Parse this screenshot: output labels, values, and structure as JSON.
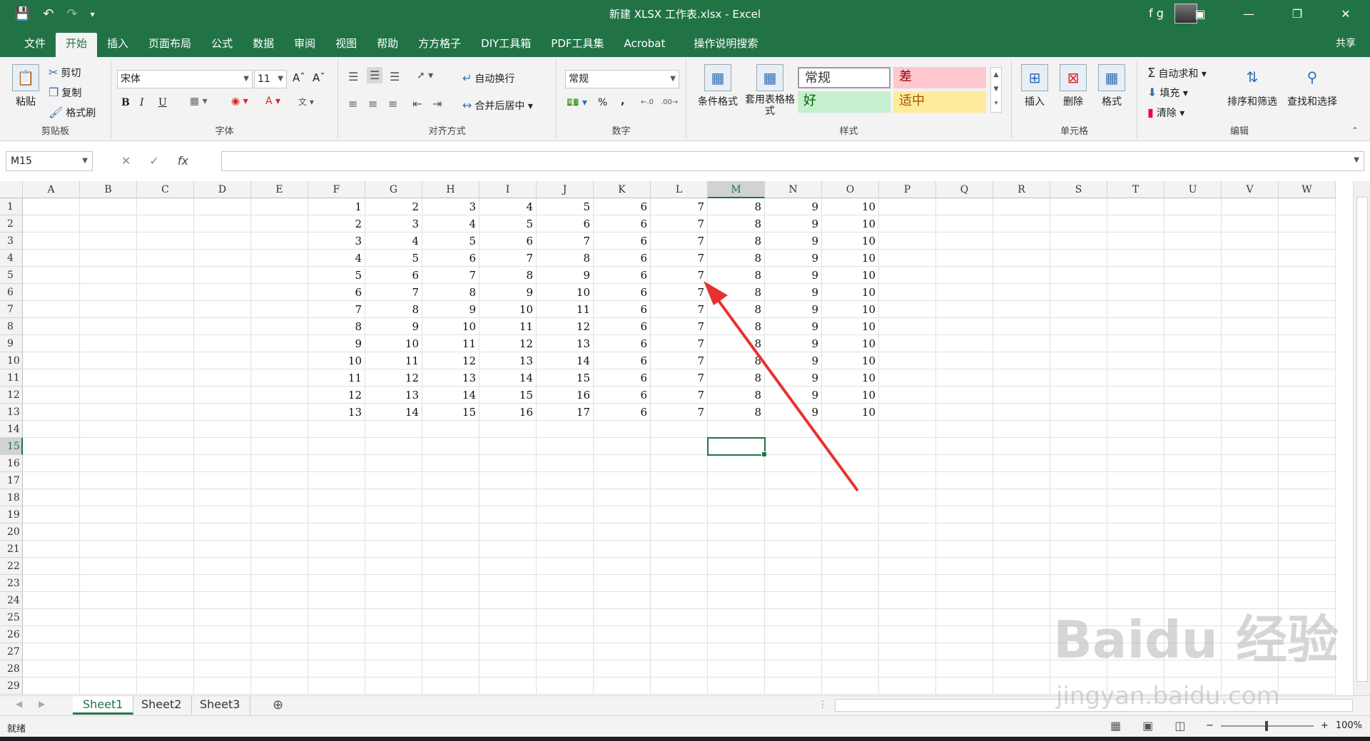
{
  "window": {
    "title": "新建 XLSX 工作表.xlsx - Excel",
    "user": "f g",
    "accent": "#217346"
  },
  "quick_access": [
    "save-icon",
    "undo-icon",
    "redo-icon",
    "customize-icon"
  ],
  "tabs": [
    "文件",
    "开始",
    "插入",
    "页面布局",
    "公式",
    "数据",
    "审阅",
    "视图",
    "帮助",
    "方方格子",
    "DIY工具箱",
    "PDF工具集",
    "Acrobat",
    "操作说明搜索"
  ],
  "share_label": "共享",
  "ribbon": {
    "clipboard": {
      "paste": "粘贴",
      "cut": "剪切",
      "copy": "复制",
      "format_painter": "格式刷",
      "label": "剪贴板"
    },
    "font": {
      "name": "宋体",
      "size": "11",
      "label": "字体",
      "bold": "B",
      "italic": "I",
      "underline": "U"
    },
    "alignment": {
      "wrap": "自动换行",
      "merge": "合并后居中",
      "label": "对齐方式"
    },
    "number": {
      "format": "常规",
      "percent": "%",
      "comma": ",",
      "label": "数字"
    },
    "styles": {
      "conditional": "条件格式",
      "table": "套用表格格式",
      "normal": "常规",
      "bad": "差",
      "good": "好",
      "neutral": "适中",
      "label": "样式"
    },
    "cells": {
      "insert": "插入",
      "delete": "删除",
      "format": "格式",
      "label": "单元格"
    },
    "editing": {
      "autosum": "自动求和",
      "fill": "填充",
      "clear": "清除",
      "sort": "排序和筛选",
      "find": "查找和选择",
      "label": "编辑"
    }
  },
  "formula_bar": {
    "name_box": "M15",
    "fx": "fx",
    "value": ""
  },
  "columns": [
    "A",
    "B",
    "C",
    "D",
    "E",
    "F",
    "G",
    "H",
    "I",
    "J",
    "K",
    "L",
    "M",
    "N",
    "O",
    "P",
    "Q",
    "R",
    "S",
    "T",
    "U",
    "V",
    "W"
  ],
  "row_count": 29,
  "selected": {
    "column": "M",
    "row": 15
  },
  "data": [
    [
      1,
      2,
      3,
      4,
      5,
      6,
      7,
      8,
      9,
      10
    ],
    [
      2,
      3,
      4,
      5,
      6,
      6,
      7,
      8,
      9,
      10
    ],
    [
      3,
      4,
      5,
      6,
      7,
      6,
      7,
      8,
      9,
      10
    ],
    [
      4,
      5,
      6,
      7,
      8,
      6,
      7,
      8,
      9,
      10
    ],
    [
      5,
      6,
      7,
      8,
      9,
      6,
      7,
      8,
      9,
      10
    ],
    [
      6,
      7,
      8,
      9,
      10,
      6,
      7,
      8,
      9,
      10
    ],
    [
      7,
      8,
      9,
      10,
      11,
      6,
      7,
      8,
      9,
      10
    ],
    [
      8,
      9,
      10,
      11,
      12,
      6,
      7,
      8,
      9,
      10
    ],
    [
      9,
      10,
      11,
      12,
      13,
      6,
      7,
      8,
      9,
      10
    ],
    [
      10,
      11,
      12,
      13,
      14,
      6,
      7,
      8,
      9,
      10
    ],
    [
      11,
      12,
      13,
      14,
      15,
      6,
      7,
      8,
      9,
      10
    ],
    [
      12,
      13,
      14,
      15,
      16,
      6,
      7,
      8,
      9,
      10
    ],
    [
      13,
      14,
      15,
      16,
      17,
      6,
      7,
      8,
      9,
      10
    ]
  ],
  "data_start_column": "F",
  "sheets": [
    "Sheet1",
    "Sheet2",
    "Sheet3"
  ],
  "active_sheet": "Sheet1",
  "status": {
    "ready": "就绪",
    "zoom": "100%"
  },
  "watermark": {
    "brand": "Baidu 经验",
    "url": "jingyan.baidu.com"
  },
  "annotation_color": "#e8312f"
}
